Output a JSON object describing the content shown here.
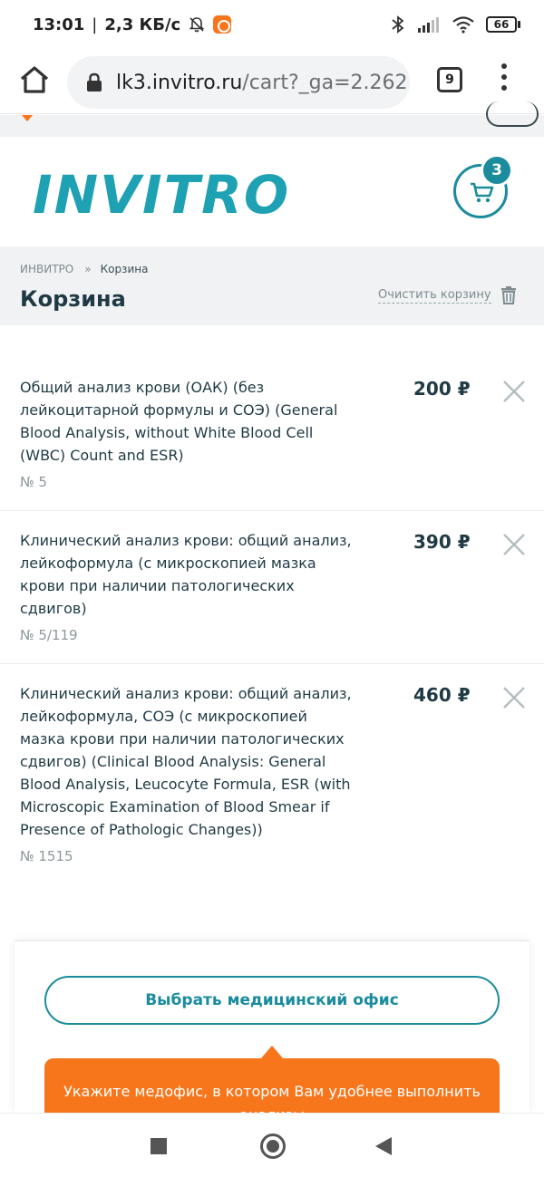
{
  "status_bar": {
    "time": "13:01",
    "separator": "|",
    "network_speed": "2,3 КБ/с",
    "battery": "66"
  },
  "browser": {
    "url_host": "lk3.invitro.ru",
    "url_path": "/cart?_ga=2.262",
    "tab_count": "9"
  },
  "header": {
    "logo": "INVITRO",
    "cart_count": "3"
  },
  "breadcrumb": {
    "home": "ИНВИТРО",
    "separator": "»",
    "current": "Корзина"
  },
  "page": {
    "title": "Корзина",
    "clear_cart_label": "Очистить корзину"
  },
  "cart_items": [
    {
      "name": "Общий анализ крови (ОАК) (без лейкоцитарной формулы и СОЭ) (General Blood Analysis, without White Blood Cell (WBC) Count and ESR)",
      "code": "№ 5",
      "price": "200 ₽"
    },
    {
      "name": "Клинический анализ крови: общий анализ, лейкоформула (с микроскопией мазка крови при наличии патологических сдвигов)",
      "code": "№ 5/119",
      "price": "390 ₽"
    },
    {
      "name": "Клинический анализ крови: общий анализ, лейкоформула, СОЭ (с микроскопией мазка крови при наличии патологических сдвигов) (Clinical Blood Analysis: General Blood Analysis, Leucocyte Formula, ESR (with Microscopic Examination of Blood Smear if Presence of Pathologic Changes))",
      "code": "№ 1515",
      "price": "460 ₽"
    }
  ],
  "office": {
    "choose_button": "Выбрать медицинский офис",
    "hint": "Укажите медофис, в котором Вам удобнее выполнить анализы"
  },
  "colors": {
    "brand_teal": "#1fa1b4",
    "accent_orange": "#f7761c",
    "text_dark": "#1f3a44"
  }
}
